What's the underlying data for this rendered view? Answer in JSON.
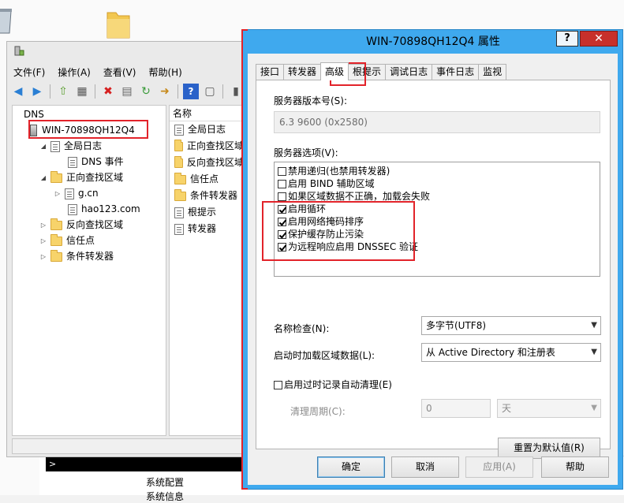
{
  "desktop": {
    "bottom_rows": [
      "系统配置",
      "系统信息"
    ]
  },
  "mmc": {
    "menu": [
      "文件(F)",
      "操作(A)",
      "查看(V)",
      "帮助(H)"
    ],
    "tree": {
      "root": "DNS",
      "server": "WIN-70898QH12Q4",
      "global_logs": "全局日志",
      "dns_events": "DNS 事件",
      "forward_zones": "正向查找区域",
      "zone_1": "g.cn",
      "zone_2": "hao123.com",
      "reverse_zones": "反向查找区域",
      "trust_points": "信任点",
      "conditional_forwarders": "条件转发器"
    },
    "list_header": "名称",
    "list_items": [
      "全局日志",
      "正向查找区域",
      "反向查找区域",
      "信任点",
      "条件转发器",
      "根提示",
      "转发器"
    ],
    "cmd_prompt": ">"
  },
  "dialog": {
    "title": "WIN-70898QH12Q4 属性",
    "help_label": "?",
    "close_label": "✕",
    "tabs": [
      "接口",
      "转发器",
      "高级",
      "根提示",
      "调试日志",
      "事件日志",
      "监视"
    ],
    "active_tab": "高级",
    "server_version_label": "服务器版本号(S):",
    "server_version_value": "6.3 9600 (0x2580)",
    "server_options_label": "服务器选项(V):",
    "options": [
      {
        "label": "禁用递归(也禁用转发器)",
        "checked": false
      },
      {
        "label": "启用 BIND 辅助区域",
        "checked": false
      },
      {
        "label": "如果区域数据不正确，加载会失败",
        "checked": false
      },
      {
        "label": "启用循环",
        "checked": true
      },
      {
        "label": "启用网络掩码排序",
        "checked": true
      },
      {
        "label": "保护缓存防止污染",
        "checked": true
      },
      {
        "label": "为远程响应启用 DNSSEC 验证",
        "checked": true
      }
    ],
    "name_check_label": "名称检查(N):",
    "name_check_value": "多字节(UTF8)",
    "load_zone_label": "启动时加载区域数据(L):",
    "load_zone_value": "从 Active Directory 和注册表",
    "scavenging_label": "启用过时记录自动清理(E)",
    "scavenging_checked": false,
    "cleanup_period_label": "清理周期(C):",
    "cleanup_period_value": "0",
    "cleanup_unit": "天",
    "reset_button": "重置为默认值(R)",
    "ok_button": "确定",
    "cancel_button": "取消",
    "apply_button": "应用(A)",
    "help_button": "帮助"
  },
  "colors": {
    "dialog_border": "#3fa9ee",
    "close_button": "#c7302b",
    "highlight_box": "#e2232a"
  }
}
